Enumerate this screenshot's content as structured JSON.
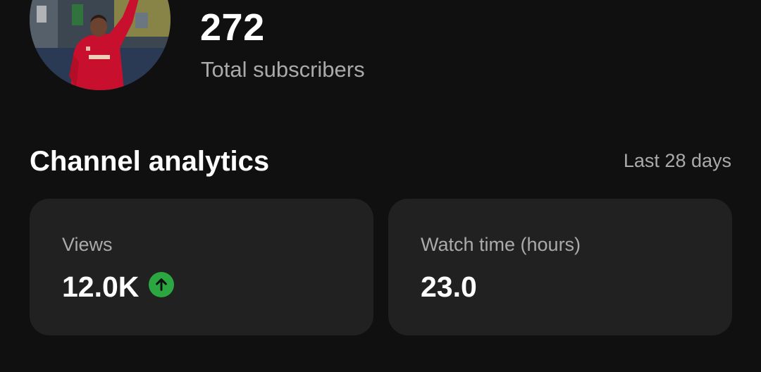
{
  "channel": {
    "subscriber_count": "272",
    "subscriber_label": "Total subscribers"
  },
  "analytics": {
    "title": "Channel analytics",
    "period": "Last 28 days",
    "cards": [
      {
        "label": "Views",
        "value": "12.0K",
        "trend": "up",
        "trend_icon": "arrow-up-icon",
        "trend_color": "#2ba640"
      },
      {
        "label": "Watch time (hours)",
        "value": "23.0"
      }
    ]
  },
  "colors": {
    "background": "#101010",
    "card": "#212121",
    "primary_text": "#ffffff",
    "secondary_text": "#aaaaaa",
    "trend_up": "#2ba640"
  }
}
